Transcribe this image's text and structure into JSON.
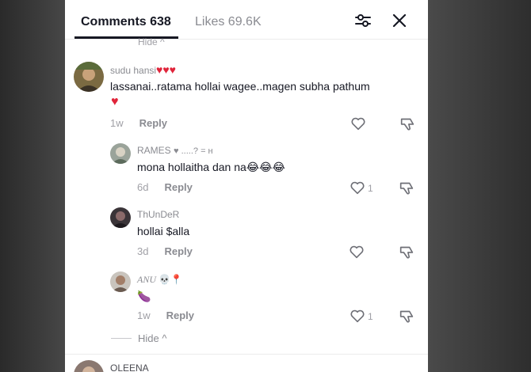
{
  "header": {
    "comments_tab": "Comments 638",
    "likes_tab": "Likes 69.6K",
    "hide_top": "Hide ^"
  },
  "comments": [
    {
      "username": "sudu hansi",
      "user_emoji": "♥♥♥",
      "text_line1": "lassanai..ratama hollai wagee..magen subha pathum",
      "text_line2": "♥",
      "time": "1w",
      "reply": "Reply",
      "likes": ""
    }
  ],
  "replies": [
    {
      "username": "RAMES",
      "user_suffix": "♥ .....? = н",
      "text": "mona hollaitha dan na😂😂😂",
      "time": "6d",
      "reply": "Reply",
      "likes": "1"
    },
    {
      "username": "ThUnDeR",
      "user_suffix": "",
      "text": "hollai $alla",
      "time": "3d",
      "reply": "Reply",
      "likes": ""
    },
    {
      "username": "ANU",
      "user_suffix": "💀📍",
      "text": "🍆",
      "time": "1w",
      "reply": "Reply",
      "likes": "1"
    }
  ],
  "hide_bottom": "Hide ^",
  "next_comment": {
    "username": "OLEENA"
  },
  "colors": {
    "text_primary": "#161823",
    "text_secondary": "#8a8b91",
    "heart_red": "#e0243a"
  }
}
